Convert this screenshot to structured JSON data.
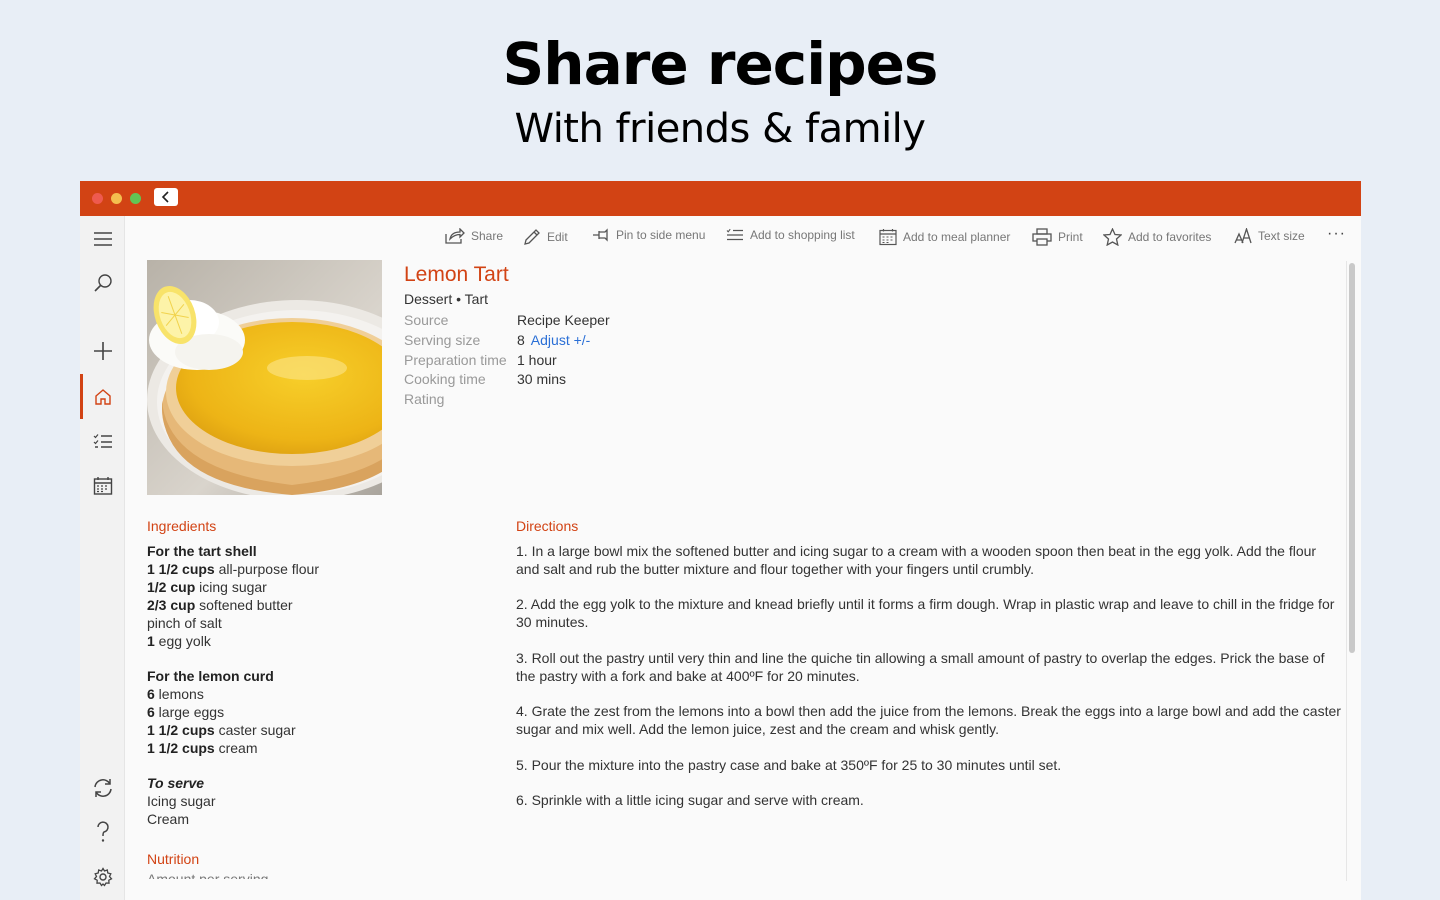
{
  "hero": {
    "title": "Share recipes",
    "subtitle": "With friends & family"
  },
  "colors": {
    "accent": "#d24314",
    "link": "#2a6fd6",
    "background": "#e8eef6"
  },
  "sidebar": {
    "items": [
      {
        "icon": "menu-icon"
      },
      {
        "icon": "search-icon"
      },
      {
        "icon": "plus-icon"
      },
      {
        "icon": "home-icon",
        "active": true
      },
      {
        "icon": "checklist-icon"
      },
      {
        "icon": "calendar-icon"
      },
      {
        "icon": "sync-icon"
      },
      {
        "icon": "help-icon"
      },
      {
        "icon": "settings-icon"
      }
    ]
  },
  "toolbar": {
    "share": "Share",
    "edit": "Edit",
    "pin": "Pin to side menu",
    "shopping": "Add to shopping list",
    "meal_planner": "Add to meal planner",
    "print": "Print",
    "favorites": "Add to favorites",
    "text_size": "Text size",
    "more": "···"
  },
  "recipe": {
    "title": "Lemon Tart",
    "category": "Dessert • Tart",
    "source_label": "Source",
    "source_value": "Recipe Keeper",
    "serving_label": "Serving size",
    "serving_value": "8",
    "adjust_link": "Adjust +/-",
    "prep_label": "Preparation time",
    "prep_value": "1 hour",
    "cook_label": "Cooking time",
    "cook_value": "30 mins",
    "rating_label": "Rating"
  },
  "ingredients": {
    "heading": "Ingredients",
    "group1_title": "For the tart shell",
    "g1": [
      {
        "qty": "1 1/2 cups",
        "text": " all-purpose flour"
      },
      {
        "qty": "1/2 cup",
        "text": " icing sugar"
      },
      {
        "qty": "2/3 cup",
        "text": " softened butter"
      },
      {
        "qty": "",
        "text": "pinch of salt"
      },
      {
        "qty": "1",
        "text": " egg yolk"
      }
    ],
    "group2_title": "For the lemon curd",
    "g2": [
      {
        "qty": "6",
        "text": " lemons"
      },
      {
        "qty": "6",
        "text": " large eggs"
      },
      {
        "qty": "1 1/2 cups",
        "text": " caster sugar"
      },
      {
        "qty": "1 1/2 cups",
        "text": " cream"
      }
    ],
    "group3_title": "To serve",
    "g3": [
      {
        "qty": "",
        "text": "Icing sugar"
      },
      {
        "qty": "",
        "text": "Cream"
      }
    ]
  },
  "nutrition": {
    "heading": "Nutrition",
    "subheading": "Amount per serving"
  },
  "directions": {
    "heading": "Directions",
    "steps": [
      "1. In a large bowl mix the softened butter and icing sugar to a cream with a wooden spoon then beat in the egg yolk. Add the flour and salt and rub the butter mixture and flour together with your fingers until crumbly.",
      "2. Add the egg yolk to the mixture and knead briefly until it forms a firm dough. Wrap in plastic wrap and leave to chill in the fridge for 30 minutes.",
      "3. Roll out the pastry until very thin and line the quiche tin allowing a small amount of pastry to overlap the edges. Prick the base of the pastry with a fork and bake at 400ºF for 20 minutes.",
      "4. Grate the zest from the lemons into a bowl then add the juice from the lemons. Break the eggs into a large bowl and add the caster sugar and mix well. Add the lemon juice, zest and the cream and whisk gently.",
      "5. Pour the mixture into the pastry case and bake at 350ºF for 25 to 30 minutes until set.",
      "6. Sprinkle with a little icing sugar and serve with cream."
    ]
  }
}
